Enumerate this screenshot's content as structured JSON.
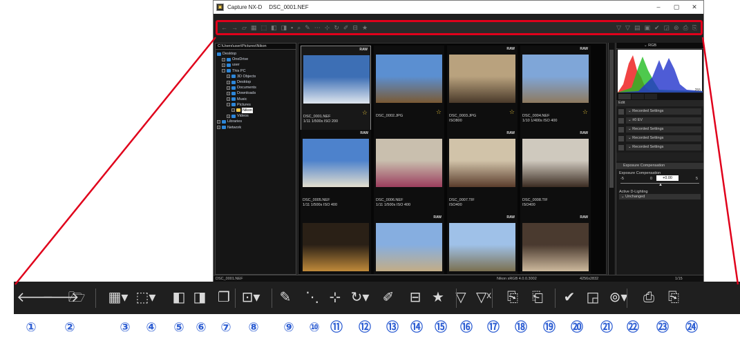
{
  "window": {
    "app_name": "Capture NX-D",
    "file_title": "DSC_0001.NEF",
    "minimize": "–",
    "restore": "▢",
    "close": "✕"
  },
  "toolbar_small": {
    "icons": [
      "←",
      "→",
      "▱",
      "▦",
      "⬚",
      "◧",
      "◨",
      "▪",
      "⌕",
      "✎",
      "⋯",
      "⊹",
      "↻",
      "✐",
      "⊟",
      "★",
      "▽",
      "▽",
      "▤",
      "▣",
      "✔",
      "◲",
      "⊚",
      "⎙",
      "⎘"
    ]
  },
  "folder_tree": {
    "path": "C:\\Users\\user\\Pictures\\Nikon",
    "nodes": [
      {
        "label": "Desktop",
        "indent": 0,
        "box": ""
      },
      {
        "label": "OneDrive",
        "indent": 1,
        "box": "+"
      },
      {
        "label": "user",
        "indent": 1,
        "box": "+"
      },
      {
        "label": "This PC",
        "indent": 1,
        "box": "−"
      },
      {
        "label": "3D Objects",
        "indent": 2,
        "box": "+"
      },
      {
        "label": "Desktop",
        "indent": 2,
        "box": "+"
      },
      {
        "label": "Documents",
        "indent": 2,
        "box": "+"
      },
      {
        "label": "Downloads",
        "indent": 2,
        "box": "+"
      },
      {
        "label": "Music",
        "indent": 2,
        "box": "+"
      },
      {
        "label": "Pictures",
        "indent": 2,
        "box": "−"
      },
      {
        "label": "Nikon",
        "indent": 3,
        "box": "+",
        "selected": true
      },
      {
        "label": "Videos",
        "indent": 2,
        "box": "+"
      },
      {
        "label": "Libraries",
        "indent": 0,
        "box": "+"
      },
      {
        "label": "Network",
        "indent": 0,
        "box": "+"
      }
    ]
  },
  "thumbnails": [
    {
      "name": "DSC_0001.NEF",
      "info": "1/11 1/500s ISO 200",
      "raw": "RAW",
      "star": "☆",
      "current": true,
      "c1": "#3d6fb5",
      "c2": "#dfe6ee"
    },
    {
      "name": "DSC_0002.JPG",
      "info": "",
      "raw": "",
      "star": "☆",
      "c1": "#5b8fd1",
      "c2": "#7a5a34"
    },
    {
      "name": "DSC_0003.JPG",
      "info": "ISO800",
      "raw": "RAW",
      "star": "☆",
      "c1": "#b9a27e",
      "c2": "#4a3a2a"
    },
    {
      "name": "DSC_0004.NEF",
      "info": "1/10 1/400s ISO 400",
      "raw": "RAW",
      "star": "☆",
      "c1": "#7fa6d8",
      "c2": "#8e7a5f"
    },
    {
      "name": "DSC_0005.NEF",
      "info": "1/11 1/500s ISO 400",
      "raw": "RAW",
      "star": "",
      "c1": "#4d82cc",
      "c2": "#e4dfcf"
    },
    {
      "name": "DSC_0006.NEF",
      "info": "1/11 1/500s ISO 400",
      "raw": "",
      "star": "",
      "c1": "#c9bfae",
      "c2": "#9b3d5d"
    },
    {
      "name": "DSC_0007.TIF",
      "info": "ISO400",
      "raw": "RAW",
      "star": "",
      "c1": "#d1c3a9",
      "c2": "#5a3c2b"
    },
    {
      "name": "DSC_0008.TIF",
      "info": "ISO400",
      "raw": "RAW",
      "star": "",
      "c1": "#cfc9be",
      "c2": "#3b2c22"
    },
    {
      "name": "",
      "info": "",
      "raw": "",
      "star": "",
      "c1": "#2a2016",
      "c2": "#c08a3a"
    },
    {
      "name": "",
      "info": "",
      "raw": "RAW",
      "star": "",
      "c1": "#86aee0",
      "c2": "#c3ad86"
    },
    {
      "name": "",
      "info": "",
      "raw": "RAW",
      "star": "",
      "c1": "#9fc1e8",
      "c2": "#7b7050"
    },
    {
      "name": "",
      "info": "",
      "raw": "RAW",
      "star": "",
      "c1": "#4a3a2f",
      "c2": "#cdb99d"
    }
  ],
  "right_panel": {
    "histogram_mode": "RGB",
    "hist_max": "255",
    "edit_label": "Edit",
    "edit_rows": [
      "Recorded Settings",
      "±0 EV",
      "Recorded Settings",
      "Recorded Settings",
      "Recorded Settings"
    ],
    "exposure_title": "Exposure Compensation",
    "exposure_label": "Exposure Compensation",
    "exposure_value": "+0.00",
    "scale_min": "-5",
    "scale_zero": "0",
    "scale_max": "5",
    "adl_label": "Active D-Lighting",
    "adl_value": "Unchanged"
  },
  "statusbar": {
    "file": "DSC_0001.NEF",
    "profile": "Nikon sRGB 4.0.0.3002",
    "dimensions": "4256x2832",
    "pager": "1/15"
  },
  "big_toolbar": {
    "icons": [
      {
        "name": "back-icon",
        "glyph": "🡐"
      },
      {
        "name": "forward-icon",
        "glyph": "🡒"
      },
      {
        "name": "open-folder-icon",
        "glyph": "🗁"
      },
      {
        "name": "thumbnail-grid-icon",
        "glyph": "▦▾"
      },
      {
        "name": "filmstrip-icon",
        "glyph": "⬚▾"
      },
      {
        "name": "compare-left-icon",
        "glyph": "◧"
      },
      {
        "name": "compare-right-icon",
        "glyph": "◨"
      },
      {
        "name": "stack-icon",
        "glyph": "❐"
      },
      {
        "name": "full-screen-icon",
        "glyph": "⊡▾"
      },
      {
        "name": "brush-icon",
        "glyph": "✎"
      },
      {
        "name": "straighten-icon",
        "glyph": "⋱"
      },
      {
        "name": "crop-icon",
        "glyph": "⊹"
      },
      {
        "name": "rotate-icon",
        "glyph": "↻▾"
      },
      {
        "name": "retouch-brush-icon",
        "glyph": "✐"
      },
      {
        "name": "color-picker-icon",
        "glyph": "⊟"
      },
      {
        "name": "rating-star-icon",
        "glyph": "★"
      },
      {
        "name": "filter-icon",
        "glyph": "▽"
      },
      {
        "name": "clear-filter-icon",
        "glyph": "▽ˣ"
      },
      {
        "name": "batch-process-icon",
        "glyph": "⎘"
      },
      {
        "name": "cancel-batch-icon",
        "glyph": "⎗"
      },
      {
        "name": "checkmark-icon",
        "glyph": "✔"
      },
      {
        "name": "open-with-icon",
        "glyph": "◲"
      },
      {
        "name": "app-icon",
        "glyph": "⊚▾"
      },
      {
        "name": "print-icon",
        "glyph": "⎙"
      },
      {
        "name": "convert-icon",
        "glyph": "⎘"
      }
    ]
  },
  "numbers": [
    "①",
    "②",
    "③",
    "④",
    "⑤",
    "⑥",
    "⑦",
    "⑧",
    "⑨",
    "⑩",
    "⑪",
    "⑫",
    "⑬",
    "⑭",
    "⑮",
    "⑯",
    "⑰",
    "⑱",
    "⑲",
    "⑳",
    "㉑",
    "㉒",
    "㉓",
    "㉔"
  ],
  "colors": {
    "callout": "#e0001b",
    "number": "#2f5fd3",
    "star": "#e8c53a"
  }
}
